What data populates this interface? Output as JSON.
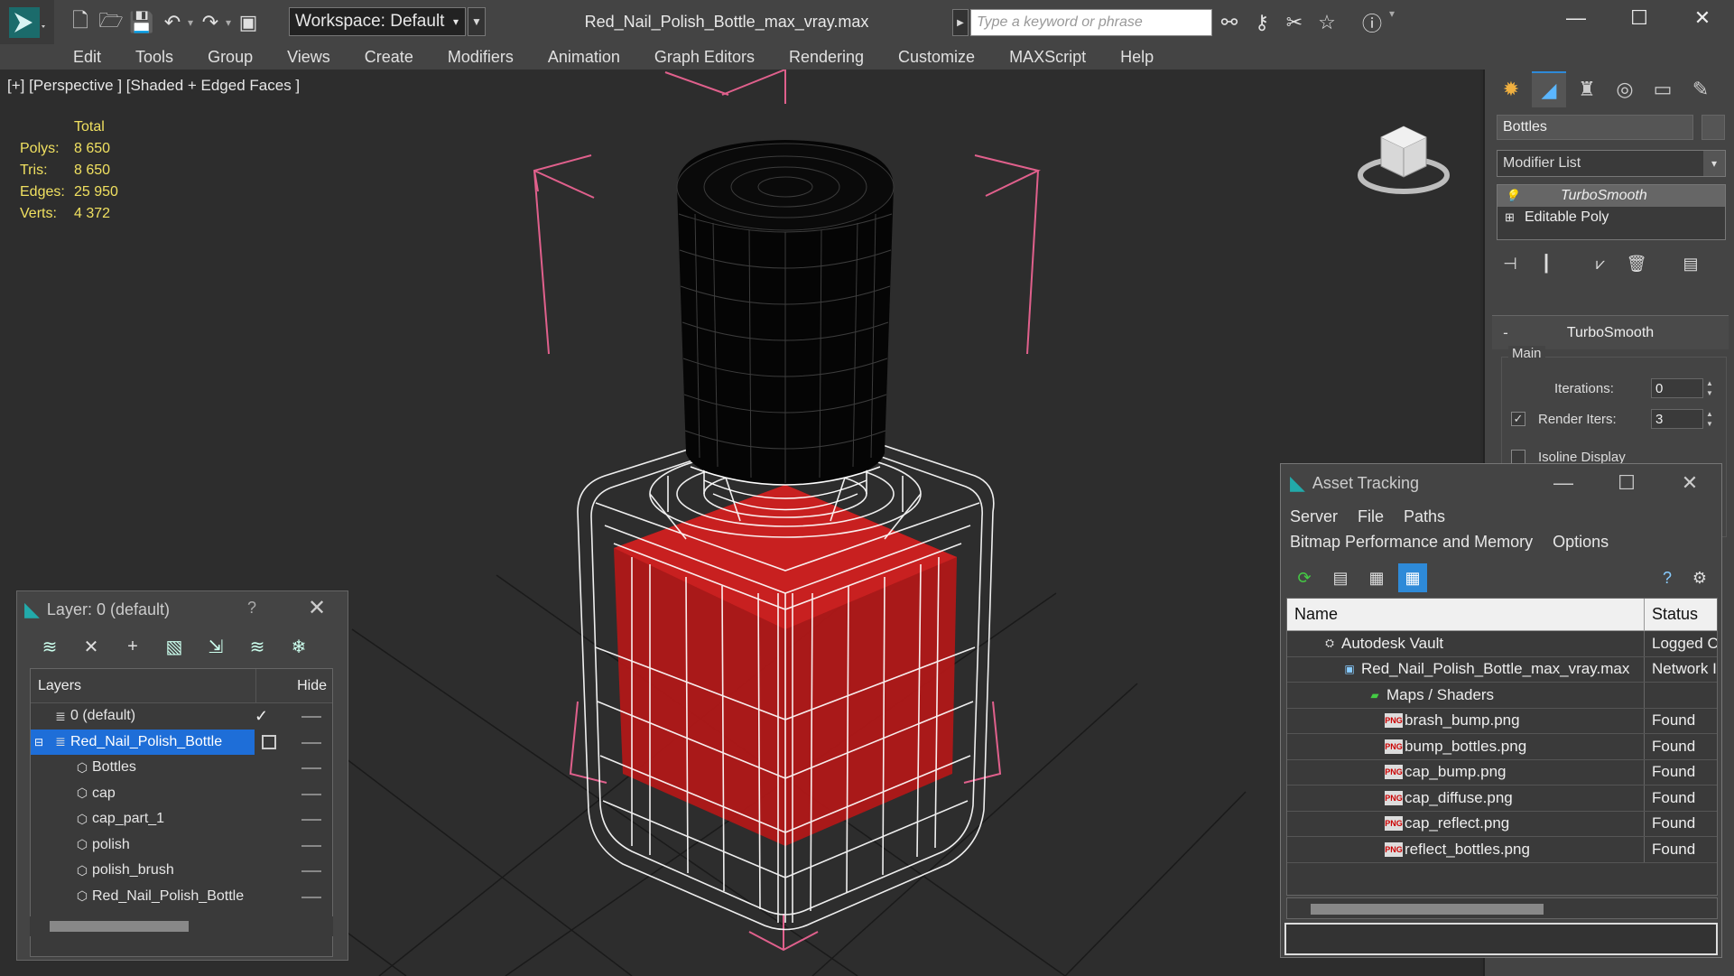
{
  "titlebar": {
    "workspace": "Workspace: Default",
    "file_title": "Red_Nail_Polish_Bottle_max_vray.max",
    "search_placeholder": "Type a keyword or phrase",
    "minimize": "—",
    "maximize": "☐",
    "close": "✕"
  },
  "menubar": {
    "items": [
      "Edit",
      "Tools",
      "Group",
      "Views",
      "Create",
      "Modifiers",
      "Animation",
      "Graph Editors",
      "Rendering",
      "Customize",
      "MAXScript",
      "Help"
    ]
  },
  "viewport": {
    "label": "[+] [Perspective ] [Shaded + Edged Faces ]",
    "stats_header": "Total",
    "stats": [
      {
        "label": "Polys:",
        "value": "8 650"
      },
      {
        "label": "Tris:",
        "value": "8 650"
      },
      {
        "label": "Edges:",
        "value": "25 950"
      },
      {
        "label": "Verts:",
        "value": "4 372"
      }
    ]
  },
  "command_panel": {
    "object_name": "Bottles",
    "modifier_list": "Modifier List",
    "stack": [
      "TurboSmooth",
      "Editable Poly"
    ],
    "rollout_title": "TurboSmooth",
    "rollout_minus": "-",
    "group_main": "Main",
    "iterations_label": "Iterations:",
    "iterations_value": "0",
    "render_iters_label": "Render Iters:",
    "render_iters_value": "3",
    "isoline_label": "Isoline Display"
  },
  "layer_panel": {
    "title": "Layer: 0 (default)",
    "help": "?",
    "close": "✕",
    "col_layers": "Layers",
    "col_hide": "Hide",
    "rows": [
      {
        "name": "0 (default)"
      },
      {
        "name": "Red_Nail_Polish_Bottle"
      },
      {
        "name": "Bottles"
      },
      {
        "name": "cap"
      },
      {
        "name": "cap_part_1"
      },
      {
        "name": "polish"
      },
      {
        "name": "polish_brush"
      },
      {
        "name": "Red_Nail_Polish_Bottle"
      }
    ]
  },
  "asset_panel": {
    "title": "Asset Tracking",
    "menu": [
      "Server",
      "File",
      "Paths",
      "Bitmap Performance and Memory",
      "Options"
    ],
    "col_name": "Name",
    "col_status": "Status",
    "rows": [
      {
        "name": "Autodesk Vault",
        "status": "Logged C"
      },
      {
        "name": "Red_Nail_Polish_Bottle_max_vray.max",
        "status": "Network I"
      },
      {
        "name": "Maps / Shaders",
        "status": ""
      },
      {
        "name": "brash_bump.png",
        "status": "Found"
      },
      {
        "name": "bump_bottles.png",
        "status": "Found"
      },
      {
        "name": "cap_bump.png",
        "status": "Found"
      },
      {
        "name": "cap_diffuse.png",
        "status": "Found"
      },
      {
        "name": "cap_reflect.png",
        "status": "Found"
      },
      {
        "name": "reflect_bottles.png",
        "status": "Found"
      }
    ]
  },
  "colors": {
    "accent": "#2e8ad8",
    "selection": "#1e6ed8",
    "stats_text": "#f0e060",
    "polish_red": "#b01818",
    "bbox_pink": "#e0608c"
  }
}
